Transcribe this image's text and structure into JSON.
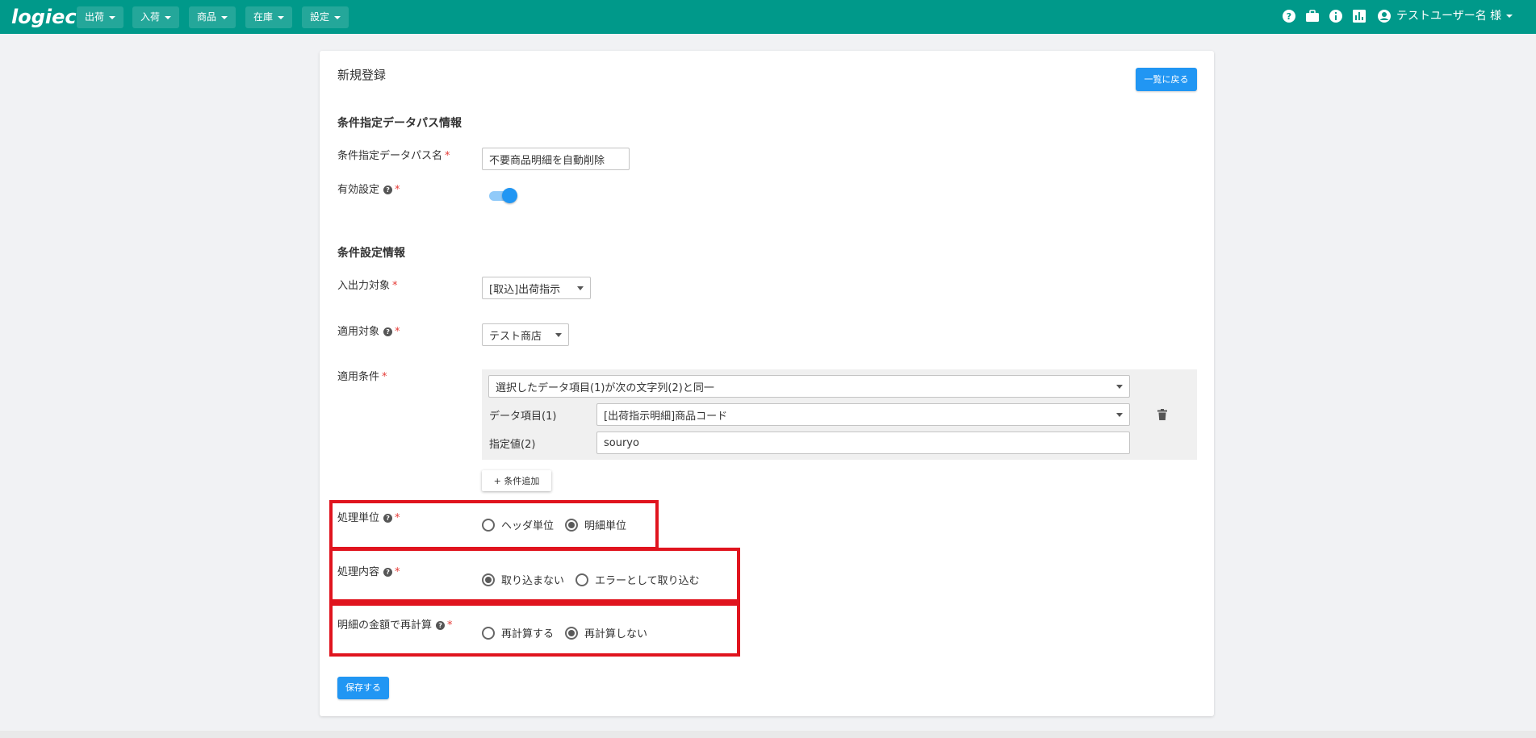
{
  "header": {
    "logo": "logiec",
    "menus": [
      "出荷",
      "入荷",
      "商品",
      "在庫",
      "設定"
    ],
    "icons": [
      "help-icon",
      "briefcase-icon",
      "info-icon",
      "chart-icon"
    ],
    "user_name": "テストユーザー名 様"
  },
  "page": {
    "title": "新規登録",
    "back_label": "一覧に戻る"
  },
  "section1": {
    "title": "条件指定データパス情報",
    "name_label": "条件指定データパス名",
    "name_value": "不要商品明細を自動削除",
    "enabled_label": "有効設定",
    "enabled": true
  },
  "section2": {
    "title": "条件設定情報",
    "io_label": "入出力対象",
    "io_value": "[取込]出荷指示",
    "apply_target_label": "適用対象",
    "apply_target_value": "テスト商店",
    "apply_cond_label": "適用条件",
    "cond_select_value": "選択したデータ項目(1)が次の文字列(2)と同一",
    "data_item_label": "データ項目(1)",
    "data_item_value": "[出荷指示明細]商品コード",
    "spec_label": "指定値(2)",
    "spec_value": "souryo",
    "add_cond_label": "+ 条件追加"
  },
  "processing_unit": {
    "label": "処理単位",
    "options": [
      "ヘッダ単位",
      "明細単位"
    ],
    "selected": "明細単位"
  },
  "processing_content": {
    "label": "処理内容",
    "options": [
      "取り込まない",
      "エラーとして取り込む"
    ],
    "selected": "取り込まない"
  },
  "recalc": {
    "label": "明細の金額で再計算",
    "options": [
      "再計算する",
      "再計算しない"
    ],
    "selected": "再計算しない"
  },
  "save_label": "保存する",
  "colors": {
    "header_bg": "#00998a",
    "primary": "#2196f3",
    "highlight": "#e0141e",
    "required": "#e53935"
  }
}
